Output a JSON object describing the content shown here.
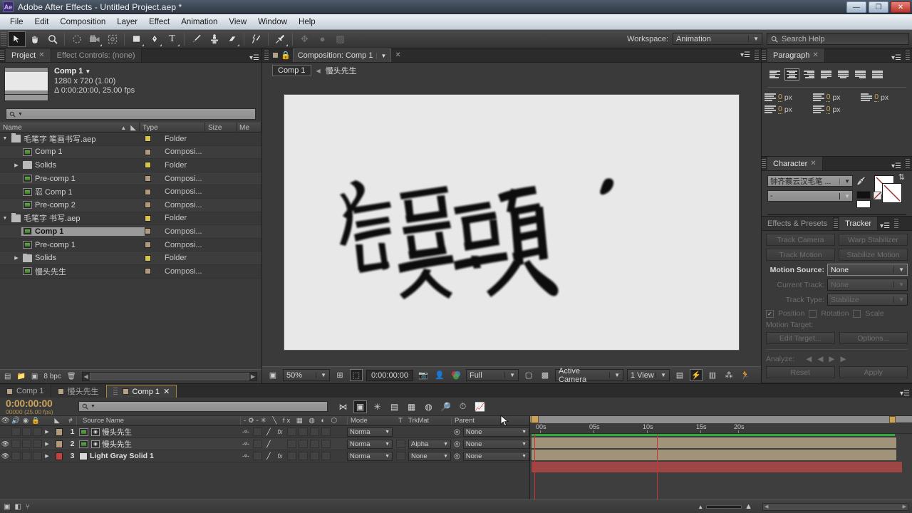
{
  "window": {
    "app_badge": "Ae",
    "title": "Adobe After Effects - Untitled Project.aep *",
    "minimize": "—",
    "restore": "❐",
    "close": "✕"
  },
  "menubar": {
    "items": [
      "File",
      "Edit",
      "Composition",
      "Layer",
      "Effect",
      "Animation",
      "View",
      "Window",
      "Help"
    ]
  },
  "toolbar": {
    "tools": [
      {
        "name": "selection-tool",
        "glyph": "➤",
        "selected": true
      },
      {
        "name": "hand-tool",
        "glyph": "✋",
        "selected": false
      },
      {
        "name": "zoom-tool",
        "glyph": "🔍",
        "selected": false
      },
      {
        "name": "rotation-tool",
        "glyph": "↻",
        "selected": false
      },
      {
        "name": "camera-tool",
        "glyph": "🎥",
        "selected": false
      },
      {
        "name": "pan-behind-tool",
        "glyph": "⛶",
        "selected": false
      },
      {
        "name": "shape-tool",
        "glyph": "■",
        "selected": false
      },
      {
        "name": "pen-tool",
        "glyph": "✒",
        "selected": false
      },
      {
        "name": "type-tool",
        "glyph": "T",
        "selected": false
      },
      {
        "name": "brush-tool",
        "glyph": "🖌",
        "selected": false
      },
      {
        "name": "clone-stamp-tool",
        "glyph": "♟",
        "selected": false
      },
      {
        "name": "eraser-tool",
        "glyph": "◗",
        "selected": false
      },
      {
        "name": "roto-brush-tool",
        "glyph": "🖍",
        "selected": false
      },
      {
        "name": "puppet-pin-tool",
        "glyph": "📌",
        "selected": false
      }
    ],
    "workspace_label": "Workspace:",
    "workspace_value": "Animation",
    "search_help_placeholder": "Search Help"
  },
  "project_panel": {
    "tabs": [
      {
        "label": "Project",
        "active": true,
        "closable": true
      },
      {
        "label": "Effect Controls: (none)",
        "active": false,
        "closable": false
      }
    ],
    "selected_item": {
      "name": "Comp 1",
      "dimensions": "1280 x 720 (1.00)",
      "duration": "Δ 0:00:20:00, 25.00 fps"
    },
    "search_placeholder": "",
    "columns": [
      "Name",
      "Type",
      "Size",
      "Me"
    ],
    "items": [
      {
        "label": "毛笔字 笔画书写.aep",
        "suffix": "",
        "kind": "folder",
        "type": "Folder",
        "indent": 0,
        "twisty": "▼",
        "selected": false,
        "swatch": "#d8c44a"
      },
      {
        "label": "Comp 1",
        "kind": "comp",
        "type": "Composi...",
        "indent": 1,
        "twisty": "",
        "selected": false,
        "swatch": "#b39a7d"
      },
      {
        "label": "Solids",
        "kind": "folder",
        "type": "Folder",
        "indent": 1,
        "twisty": "▶",
        "selected": false,
        "swatch": "#d8c44a"
      },
      {
        "label": "Pre-comp 1",
        "kind": "comp",
        "type": "Composi...",
        "indent": 1,
        "twisty": "",
        "selected": false,
        "swatch": "#b39a7d"
      },
      {
        "label": "忍 Comp 1",
        "kind": "comp",
        "type": "Composi...",
        "indent": 1,
        "twisty": "",
        "selected": false,
        "swatch": "#b39a7d"
      },
      {
        "label": "Pre-comp 2",
        "kind": "comp",
        "type": "Composi...",
        "indent": 1,
        "twisty": "",
        "selected": false,
        "swatch": "#b39a7d"
      },
      {
        "label": "毛笔字 书写.aep",
        "kind": "folder",
        "type": "Folder",
        "indent": 0,
        "twisty": "▼",
        "selected": false,
        "swatch": "#d8c44a"
      },
      {
        "label": "Comp 1",
        "kind": "comp",
        "type": "Composi...",
        "indent": 1,
        "twisty": "",
        "selected": true,
        "swatch": "#b39a7d"
      },
      {
        "label": "Pre-comp 1",
        "kind": "comp",
        "type": "Composi...",
        "indent": 1,
        "twisty": "",
        "selected": false,
        "swatch": "#b39a7d"
      },
      {
        "label": "Solids",
        "kind": "folder",
        "type": "Folder",
        "indent": 1,
        "twisty": "▶",
        "selected": false,
        "swatch": "#d8c44a"
      },
      {
        "label": "慢头先生",
        "kind": "comp",
        "type": "Composi...",
        "indent": 1,
        "twisty": "",
        "selected": false,
        "swatch": "#b39a7d"
      }
    ],
    "footer": {
      "bit_depth": "8 bpc"
    }
  },
  "comp_viewer": {
    "tab_label": "Composition: Comp 1",
    "breadcrumb_button": "Comp 1",
    "breadcrumb_text": "慢头先生",
    "canvas_text": "馒頭",
    "footer": {
      "magnification": "50%",
      "timecode": "0:00:00:00",
      "resolution": "Full",
      "camera": "Active Camera",
      "views": "1 View"
    }
  },
  "paragraph_panel": {
    "tab_label": "Paragraph",
    "align_buttons": [
      {
        "name": "align-left",
        "selected": false
      },
      {
        "name": "align-center",
        "selected": true
      },
      {
        "name": "align-right",
        "selected": false
      },
      {
        "name": "justify-last-left",
        "selected": false
      },
      {
        "name": "justify-last-center",
        "selected": false
      },
      {
        "name": "justify-last-right",
        "selected": false
      },
      {
        "name": "justify-all",
        "selected": false
      }
    ],
    "fields": [
      {
        "name": "indent-left-margin",
        "value": "0",
        "unit": "px"
      },
      {
        "name": "indent-right-margin",
        "value": "0",
        "unit": "px"
      },
      {
        "name": "indent-first-line",
        "value": "0",
        "unit": "px"
      },
      {
        "name": "space-before-paragraph",
        "value": "0",
        "unit": "px"
      },
      {
        "name": "space-after-paragraph",
        "value": "0",
        "unit": "px"
      }
    ]
  },
  "character_panel": {
    "tab_label": "Character",
    "font_family": "钟齐蔡云汉毛笔 ...",
    "font_style": "-",
    "fill_color": "#ffffff",
    "stroke_color": "#ffffff",
    "fill_swatch": "#111111",
    "stroke_swatch": "#ffffff"
  },
  "tracker_panel": {
    "tabs": [
      {
        "label": "Effects & Presets",
        "active": false
      },
      {
        "label": "Tracker",
        "active": true
      }
    ],
    "buttons": [
      "Track Camera",
      "Warp Stabilizer",
      "Track Motion",
      "Stabilize Motion"
    ],
    "motion_source_label": "Motion Source:",
    "motion_source_value": "None",
    "current_track_label": "Current Track:",
    "current_track_value": "None",
    "track_type_label": "Track Type:",
    "track_type_value": "Stabilize",
    "checkboxes": [
      {
        "label": "Position",
        "checked": true
      },
      {
        "label": "Rotation",
        "checked": false
      },
      {
        "label": "Scale",
        "checked": false
      }
    ],
    "motion_target_label": "Motion Target:",
    "edit_target_button": "Edit Target...",
    "options_button": "Options...",
    "analyze_label": "Analyze:",
    "reset_button": "Reset",
    "apply_button": "Apply"
  },
  "timeline": {
    "tabs": [
      {
        "label": "Comp 1",
        "active": false
      },
      {
        "label": "慢头先生",
        "active": false
      },
      {
        "label": "Comp 1",
        "active": true
      }
    ],
    "current_time": "0:00:00:00",
    "frame_info": "00000 (25.00 fps)",
    "search_placeholder": "",
    "columns": [
      "#",
      "Source Name",
      "Mode",
      "T",
      "TrkMat",
      "Parent"
    ],
    "layers": [
      {
        "index": "1",
        "source_name": "慢头先生",
        "kind": "comp",
        "mode": "Norma",
        "trkmat": "",
        "parent": "None",
        "visible": false,
        "color": "#b39a7d",
        "bar_color": "#a0937a",
        "has_fx": true
      },
      {
        "index": "2",
        "source_name": "慢头先生",
        "kind": "comp",
        "mode": "Norma",
        "trkmat": "Alpha",
        "parent": "None",
        "visible": true,
        "color": "#b39a7d",
        "bar_color": "#a0937a",
        "has_fx": false
      },
      {
        "index": "3",
        "source_name": "Light Gray Solid 1",
        "kind": "solid",
        "mode": "Norma",
        "trkmat": "None",
        "parent": "None",
        "visible": true,
        "color": "#c1413f",
        "bar_color": "#9e4646",
        "has_fx": true
      }
    ],
    "ruler_ticks": [
      "00s",
      "05s",
      "10s",
      "15s",
      "20s"
    ],
    "playhead_time": "0s",
    "red_marker_time": "11s",
    "accent_color": "#c9a35c",
    "green_bar_color": "#2fa83f"
  }
}
